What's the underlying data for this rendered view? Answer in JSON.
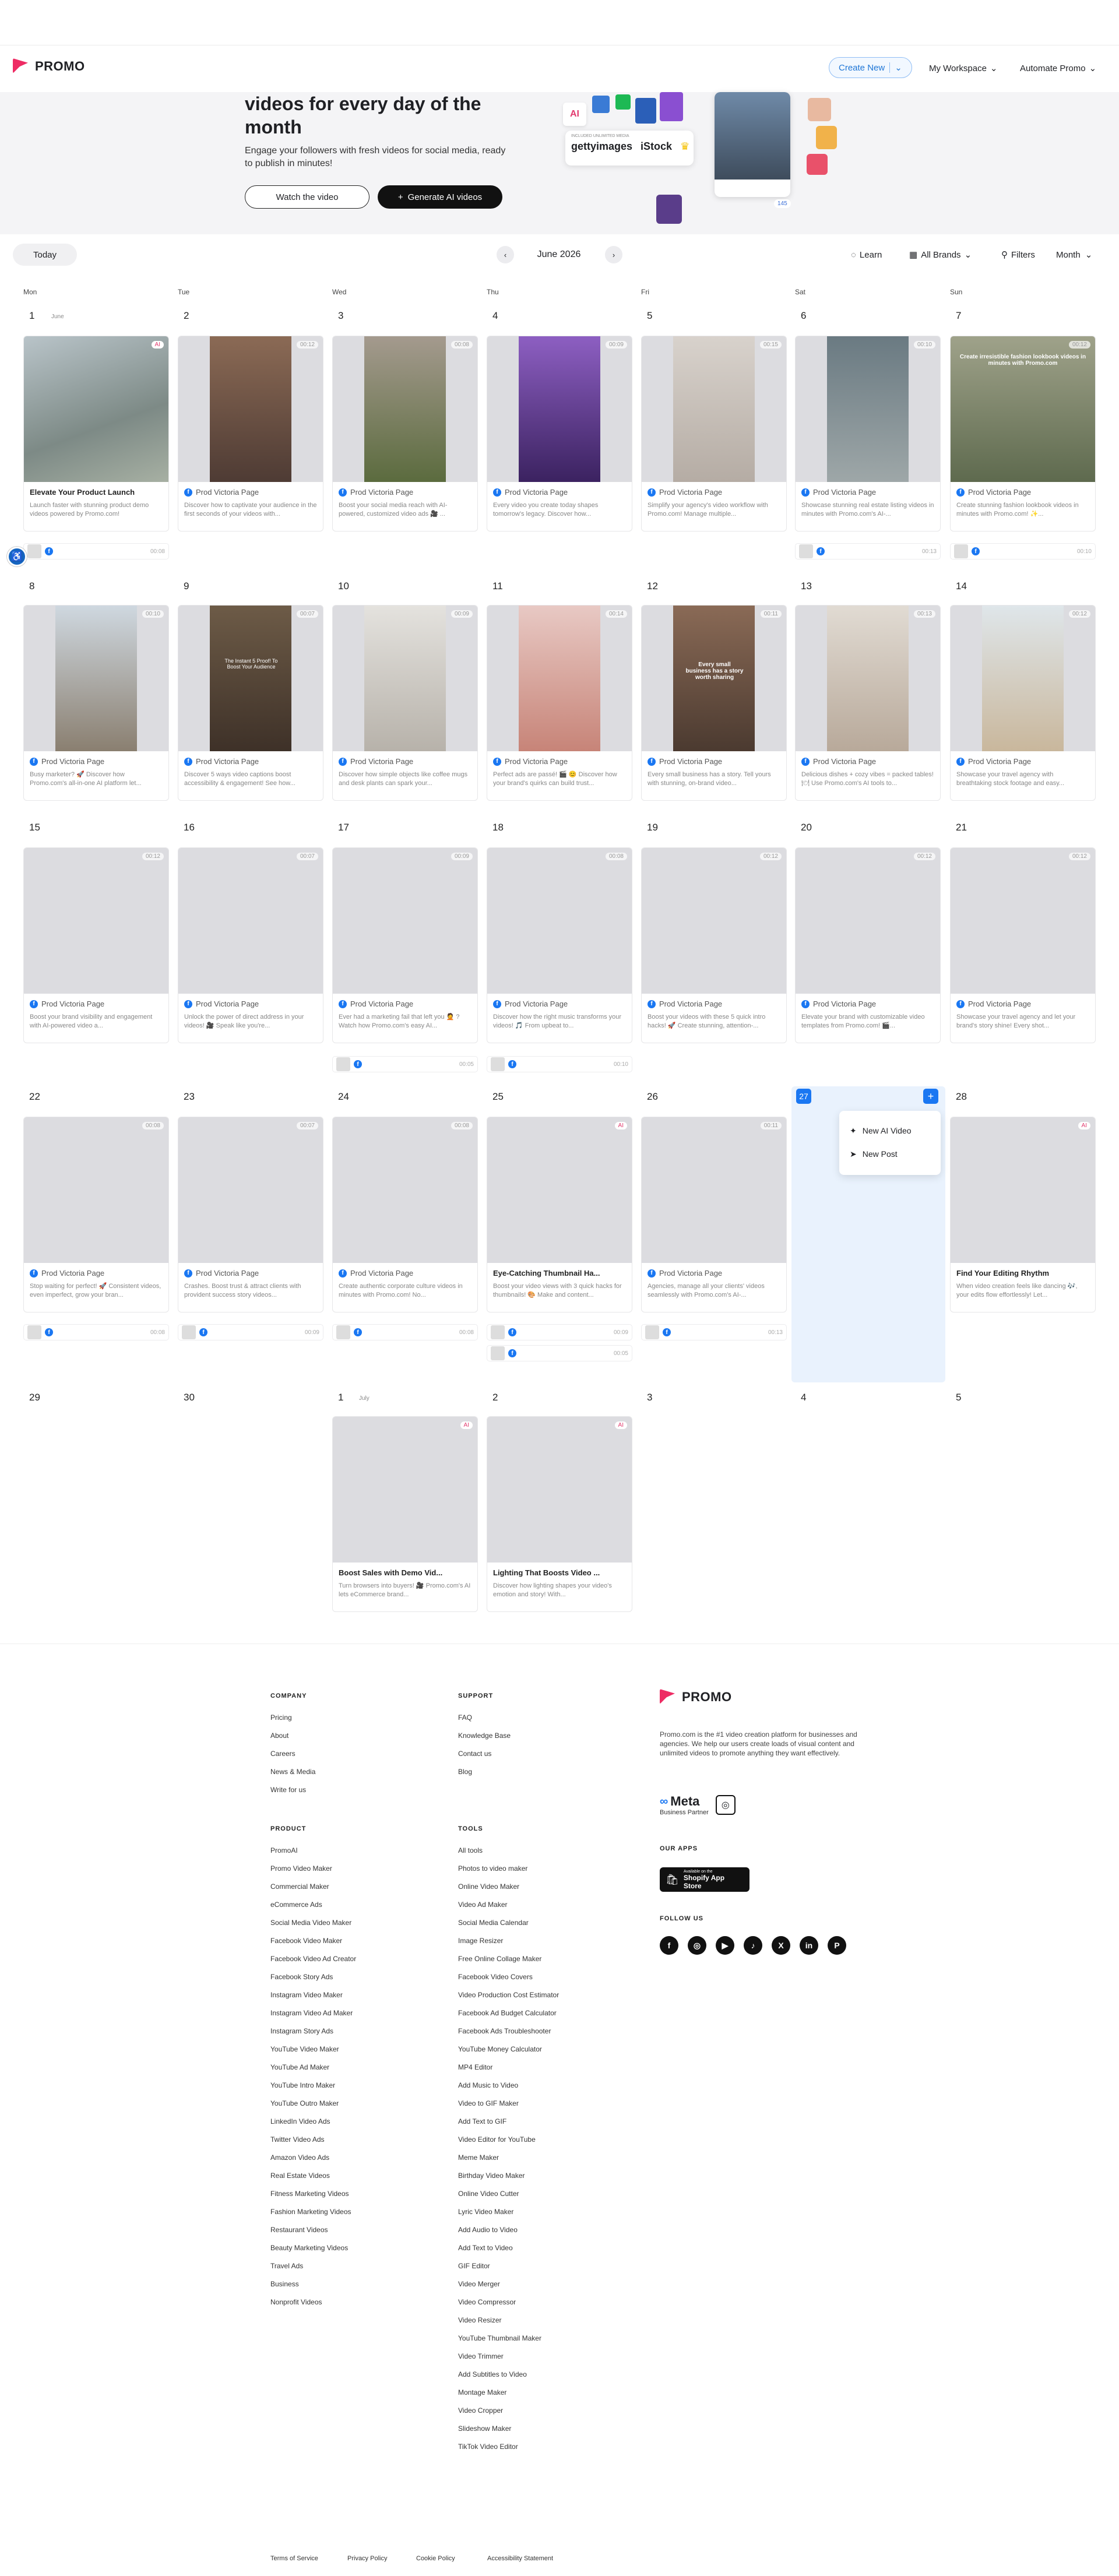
{
  "brand": {
    "name": "PROMO"
  },
  "nav": {
    "create_new": "Create New",
    "workspace": "My Workspace",
    "automate": "Automate Promo"
  },
  "hero": {
    "title": "videos for every day of the month",
    "subtitle": "Engage your followers with fresh videos for social media, ready to publish in minutes!",
    "watch": "Watch the video",
    "generate": "Generate AI videos",
    "collage": {
      "included": "INCLUDED UNLIMITED MEDIA",
      "getty": "gettyimages",
      "istock": "iStock",
      "ai": "AI",
      "likes": "145"
    }
  },
  "controls": {
    "today": "Today",
    "month_label": "June 2026",
    "learn": "Learn",
    "brands": "All Brands",
    "filters": "Filters",
    "view": "Month"
  },
  "weekdays": [
    "Mon",
    "Tue",
    "Wed",
    "Thu",
    "Fri",
    "Sat",
    "Sun"
  ],
  "colors": {
    "accent": "#1a77f2",
    "brand": "#ee2c64",
    "ai": "#e23a6e"
  },
  "months": {
    "june": "June",
    "july": "July"
  },
  "days": {
    "w1": [
      "1",
      "2",
      "3",
      "4",
      "5",
      "6",
      "7"
    ],
    "w2": [
      "8",
      "9",
      "10",
      "11",
      "12",
      "13",
      "14"
    ],
    "w3": [
      "15",
      "16",
      "17",
      "18",
      "19",
      "20",
      "21"
    ],
    "w4": [
      "22",
      "23",
      "24",
      "25",
      "26",
      "27",
      "28"
    ],
    "w5": [
      "29",
      "30",
      "1",
      "2",
      "3",
      "4",
      "5"
    ]
  },
  "cards": {
    "c1": {
      "title": "Elevate Your Product Launch",
      "desc": "Launch faster with stunning product demo videos powered by Promo.com!",
      "tag": "AI"
    },
    "c2": {
      "page": "Prod Victoria Page",
      "desc": "Discover how to captivate your audience in the first seconds of your videos with...",
      "dur": "00:12"
    },
    "c3": {
      "page": "Prod Victoria Page",
      "desc": "Boost your social media reach with AI-powered, customized video ads 🎥 ...",
      "dur": "00:08"
    },
    "c4": {
      "page": "Prod Victoria Page",
      "desc": "Every video you create today shapes tomorrow's legacy. Discover how...",
      "dur": "00:09"
    },
    "c5": {
      "page": "Prod Victoria Page",
      "desc": "Simplify your agency's video workflow with Promo.com! Manage multiple...",
      "dur": "00:15"
    },
    "c6": {
      "page": "Prod Victoria Page",
      "desc": "Showcase stunning real estate listing videos in minutes with Promo.com's AI-...",
      "dur": "00:10"
    },
    "c7": {
      "page": "Prod Victoria Page",
      "desc": "Create stunning fashion lookbook videos in minutes with Promo.com! ✨...",
      "dur": "00:12"
    },
    "c8": {
      "page": "Prod Victoria Page",
      "desc": "Busy marketer? 🚀 Discover how Promo.com's all-in-one AI platform let...",
      "dur": "00:10"
    },
    "c9": {
      "page": "Prod Victoria Page",
      "desc": "Discover 5 ways video captions boost accessibility & engagement! See how...",
      "dur": "00:07"
    },
    "c10": {
      "page": "Prod Victoria Page",
      "desc": "Discover how simple objects like coffee mugs and desk plants can spark your...",
      "dur": "00:09"
    },
    "c11": {
      "page": "Prod Victoria Page",
      "desc": "Perfect ads are passé! 🎬 😊 Discover how your brand's quirks can build trust...",
      "dur": "00:14"
    },
    "c12": {
      "page": "Prod Victoria Page",
      "desc": "Every small business has a story. Tell yours with stunning, on-brand video...",
      "dur": "00:11"
    },
    "c13": {
      "page": "Prod Victoria Page",
      "desc": "Delicious dishes + cozy vibes = packed tables! 🍽 Use Promo.com's AI tools to...",
      "dur": "00:13"
    },
    "c14": {
      "page": "Prod Victoria Page",
      "desc": "Showcase your travel agency with breathtaking stock footage and easy...",
      "dur": "00:12"
    },
    "c15": {
      "page": "Prod Victoria Page",
      "desc": "Boost your brand visibility and engagement with AI-powered video a...",
      "dur": "00:12"
    },
    "c16": {
      "page": "Prod Victoria Page",
      "desc": "Unlock the power of direct address in your videos! 🎥 Speak like you're...",
      "dur": "00:07"
    },
    "c17": {
      "page": "Prod Victoria Page",
      "desc": "Ever had a marketing fail that left you 🤦 ? Watch how Promo.com's easy AI...",
      "dur": "00:09"
    },
    "c18": {
      "page": "Prod Victoria Page",
      "desc": "Discover how the right music transforms your videos! 🎵 From upbeat to...",
      "dur": "00:08"
    },
    "c19": {
      "page": "Prod Victoria Page",
      "desc": "Boost your videos with these 5 quick intro hacks! 🚀 Create stunning, attention-...",
      "dur": "00:12"
    },
    "c20": {
      "page": "Prod Victoria Page",
      "desc": "Elevate your brand with customizable video templates from Promo.com! 🎬...",
      "dur": "00:12"
    },
    "c21": {
      "page": "Prod Victoria Page",
      "desc": "Showcase your travel agency and let your brand's story shine! Every shot...",
      "dur": "00:12"
    },
    "c22": {
      "page": "Prod Victoria Page",
      "desc": "Stop waiting for perfect! 🚀 Consistent videos, even imperfect, grow your bran...",
      "dur": "00:08"
    },
    "c23": {
      "page": "Prod Victoria Page",
      "desc": "Crashes. Boost trust & attract clients with provident success story videos...",
      "dur": "00:07"
    },
    "c24": {
      "page": "Prod Victoria Page",
      "desc": "Create authentic corporate culture videos in minutes with Promo.com! No...",
      "dur": "00:08"
    },
    "c25": {
      "title": "Eye-Catching Thumbnail Ha...",
      "desc": "Boost your video views with 3 quick hacks for thumbnails! 🎨 Make and content...",
      "tag": "AI"
    },
    "c26": {
      "page": "Prod Victoria Page",
      "desc": "Agencies, manage all your clients' videos seamlessly with Promo.com's AI-...",
      "dur": "00:11"
    },
    "c28": {
      "title": "Find Your Editing Rhythm",
      "desc": "When video creation feels like dancing 🎶, your edits flow effortlessly! Let...",
      "tag": "AI"
    },
    "c_j1": {
      "title": "Boost Sales with Demo Vid...",
      "desc": "Turn browsers into buyers! 🎥 Promo.com's AI lets eCommerce brand...",
      "tag": "AI"
    },
    "c_j2": {
      "title": "Lighting That Boosts Video ...",
      "desc": "Discover how lighting shapes your video's emotion and story! With...",
      "tag": "AI"
    }
  },
  "extras": {
    "e1": "00:08",
    "e6": "00:13",
    "e7": "00:10",
    "e17": "00:05",
    "e18": "00:10",
    "e22": "00:08",
    "e23": "00:09",
    "e24": "00:08",
    "e25a": "00:09",
    "e25b": "00:05",
    "e26": "00:13"
  },
  "thumb_text": {
    "t6": "Create irresistible fashion lookbook videos in minutes with Promo.com",
    "t9": "The Instant 5 Proof! To Boost Your Audience",
    "t12": "Every small business has a story worth sharing"
  },
  "today_menu": {
    "day": "27",
    "ai_video": "New AI Video",
    "post": "New Post"
  },
  "footer": {
    "company_head": "COMPANY",
    "company": [
      "Pricing",
      "About",
      "Careers",
      "News & Media",
      "Write for us"
    ],
    "support_head": "SUPPORT",
    "support": [
      "FAQ",
      "Knowledge Base",
      "Contact us",
      "Blog"
    ],
    "product_head": "PRODUCT",
    "product": [
      "PromoAI",
      "Promo Video Maker",
      "Commercial Maker",
      "eCommerce Ads",
      "Social Media Video Maker",
      "Facebook Video Maker",
      "Facebook Video Ad Creator",
      "Facebook Story Ads",
      "Instagram Video Maker",
      "Instagram Video Ad Maker",
      "Instagram Story Ads",
      "YouTube Video Maker",
      "YouTube Ad Maker",
      "YouTube Intro Maker",
      "YouTube Outro Maker",
      "LinkedIn Video Ads",
      "Twitter Video Ads",
      "Amazon Video Ads",
      "Real Estate Videos",
      "Fitness Marketing Videos",
      "Fashion Marketing Videos",
      "Restaurant Videos",
      "Beauty Marketing Videos",
      "Travel Ads",
      "Business",
      "Nonprofit Videos"
    ],
    "tools_head": "TOOLS",
    "tools": [
      "All tools",
      "Photos to video maker",
      "Online Video Maker",
      "Video Ad Maker",
      "Social Media Calendar",
      "Image Resizer",
      "Free Online Collage Maker",
      "Facebook Video Covers",
      "Video Production Cost Estimator",
      "Facebook Ad Budget Calculator",
      "Facebook Ads Troubleshooter",
      "YouTube Money Calculator",
      "MP4 Editor",
      "Add Music to Video",
      "Video to GIF Maker",
      "Add Text to GIF",
      "Video Editor for YouTube",
      "Meme Maker",
      "Birthday Video Maker",
      "Online Video Cutter",
      "Lyric Video Maker",
      "Add Audio to Video",
      "Add Text to Video",
      "GIF Editor",
      "Video Merger",
      "Video Compressor",
      "Video Resizer",
      "YouTube Thumbnail Maker",
      "Video Trimmer",
      "Add Subtitles to Video",
      "Montage Maker",
      "Video Cropper",
      "Slideshow Maker",
      "TikTok Video Editor"
    ],
    "about": "Promo.com is the #1 video creation platform for businesses and agencies. We help our users create loads of visual content and unlimited videos to promote anything they want effectively.",
    "meta": "Meta",
    "meta_sub": "Business Partner",
    "apps_head": "OUR APPS",
    "shopify_small": "Available on the",
    "shopify": "Shopify App Store",
    "follow_head": "FOLLOW US",
    "legal": [
      "Terms of Service",
      "Privacy Policy",
      "Cookie Policy",
      "Accessibility Statement"
    ]
  }
}
